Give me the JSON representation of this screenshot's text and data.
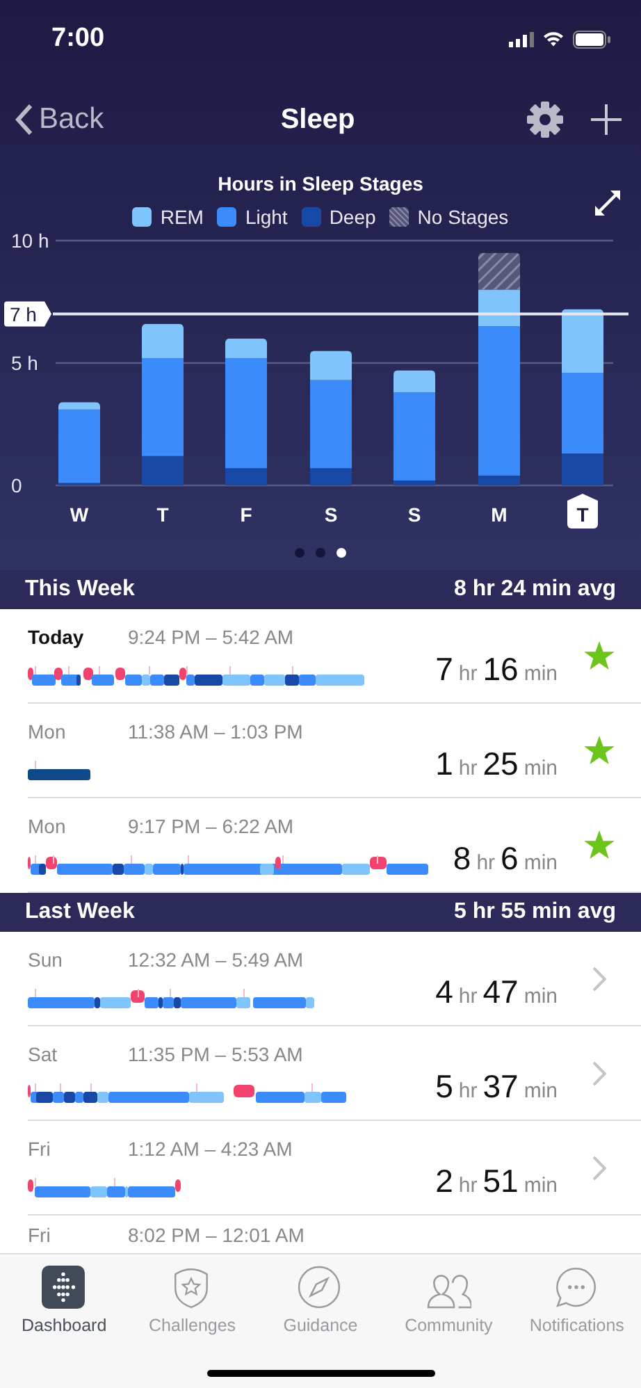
{
  "status_bar": {
    "time": "7:00"
  },
  "nav": {
    "back": "Back",
    "title": "Sleep"
  },
  "chart": {
    "title": "Hours in Sleep Stages",
    "days": [
      {
        "selected": false
      },
      {
        "selected": false
      },
      {
        "selected": false
      },
      {
        "selected": false
      },
      {
        "selected": false
      },
      {
        "selected": false
      },
      {
        "selected": true
      }
    ],
    "chart_data": {
      "type": "bar",
      "stacked": true,
      "categories": [
        "W",
        "T",
        "F",
        "S",
        "S",
        "M",
        "T"
      ],
      "series": [
        {
          "name": "Deep",
          "color": "#1848a6",
          "values": [
            0.1,
            1.2,
            0.7,
            0.7,
            0.2,
            0.4,
            1.3
          ]
        },
        {
          "name": "Light",
          "color": "#3b8bfb",
          "values": [
            3.0,
            4.0,
            4.5,
            3.6,
            3.6,
            6.1,
            3.3
          ]
        },
        {
          "name": "REM",
          "color": "#80c4fe",
          "values": [
            0.3,
            1.4,
            0.8,
            1.2,
            0.9,
            1.5,
            2.6
          ]
        },
        {
          "name": "No Stages",
          "color": "#56567a",
          "values": [
            null,
            null,
            null,
            null,
            null,
            1.5,
            null
          ]
        }
      ],
      "ylim": [
        0,
        10
      ],
      "yticks": [
        0,
        {
          "value": 5,
          "label": "5 h"
        },
        {
          "value": 10,
          "label": "10 h"
        }
      ],
      "ref_lines": [
        {
          "axis": "y",
          "value": 5
        },
        {
          "axis": "y",
          "value": 7,
          "label": "7 h"
        }
      ]
    }
  },
  "pager": [
    {
      "selected": false
    },
    {
      "selected": false
    },
    {
      "selected": true
    }
  ],
  "sections": [
    {
      "title": "This Week",
      "average": "8 hr 24 min avg",
      "rows": [
        {
          "day": "Today",
          "current": true,
          "time": "9:24 PM – 5:42 AM",
          "hours": "7",
          "hours_unit": "hr",
          "minutes": "16",
          "minutes_unit": "min",
          "kind": "star"
        },
        {
          "day": "Mon",
          "current": false,
          "time": "11:38 AM – 1:03 PM",
          "hours": "1",
          "hours_unit": "hr",
          "minutes": "25",
          "minutes_unit": "min",
          "kind": "star"
        },
        {
          "day": "Mon",
          "current": false,
          "time": "9:17 PM – 6:22 AM",
          "hours": "8",
          "hours_unit": "hr",
          "minutes": "6",
          "minutes_unit": "min",
          "kind": "star"
        }
      ]
    },
    {
      "title": "Last Week",
      "average": "5 hr 55 min avg",
      "rows": [
        {
          "day": "Sun",
          "current": false,
          "time": "12:32 AM – 5:49 AM",
          "hours": "4",
          "hours_unit": "hr",
          "minutes": "47",
          "minutes_unit": "min",
          "kind": "chevron"
        },
        {
          "day": "Sat",
          "current": false,
          "time": "11:35 PM – 5:53 AM",
          "hours": "5",
          "hours_unit": "hr",
          "minutes": "37",
          "minutes_unit": "min",
          "kind": "chevron"
        },
        {
          "day": "Fri",
          "current": false,
          "time": "1:12 AM – 4:23 AM",
          "hours": "2",
          "hours_unit": "hr",
          "minutes": "51",
          "minutes_unit": "min",
          "kind": "chevron"
        },
        {
          "day": "Fri",
          "current": false,
          "time": "8:02 PM – 12:01 AM"
        }
      ]
    }
  ],
  "tab_bar": [
    {
      "label": "Dashboard",
      "selected": true
    },
    {
      "label": "Challenges",
      "selected": false
    },
    {
      "label": "Guidance",
      "selected": false
    },
    {
      "label": "Community",
      "selected": false
    },
    {
      "label": "Notifications",
      "selected": false
    }
  ]
}
